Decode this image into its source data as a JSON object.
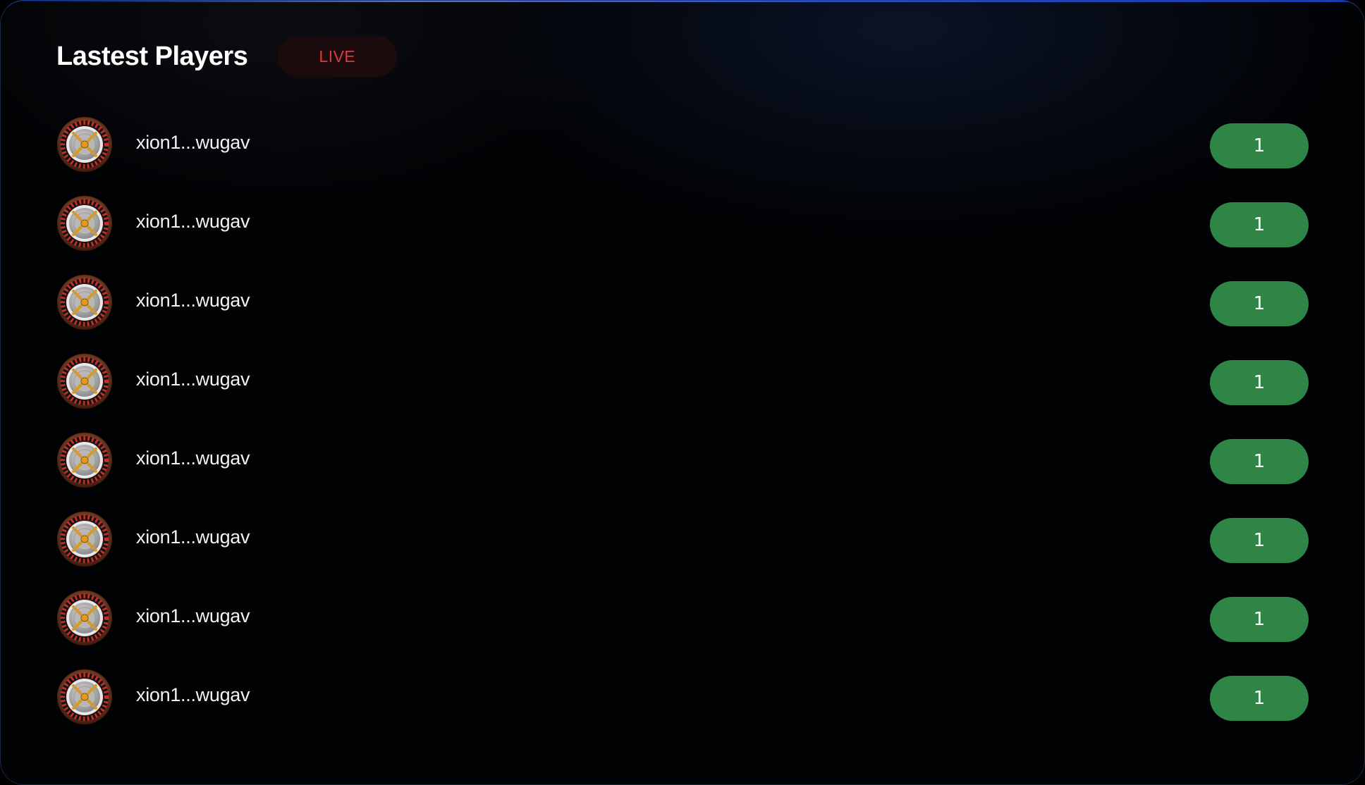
{
  "header": {
    "title": "Lastest Players",
    "live_label": "LIVE"
  },
  "players": [
    {
      "name": "xion1...wugav",
      "value": "1",
      "avatar_icon": "roulette-wheel-icon"
    },
    {
      "name": "xion1...wugav",
      "value": "1",
      "avatar_icon": "roulette-wheel-icon"
    },
    {
      "name": "xion1...wugav",
      "value": "1",
      "avatar_icon": "roulette-wheel-icon"
    },
    {
      "name": "xion1...wugav",
      "value": "1",
      "avatar_icon": "roulette-wheel-icon"
    },
    {
      "name": "xion1...wugav",
      "value": "1",
      "avatar_icon": "roulette-wheel-icon"
    },
    {
      "name": "xion1...wugav",
      "value": "1",
      "avatar_icon": "roulette-wheel-icon"
    },
    {
      "name": "xion1...wugav",
      "value": "1",
      "avatar_icon": "roulette-wheel-icon"
    },
    {
      "name": "xion1...wugav",
      "value": "1",
      "avatar_icon": "roulette-wheel-icon"
    }
  ],
  "colors": {
    "background": "#010204",
    "live_text": "#e0383f",
    "live_bg": "#1b0b0d",
    "value_pill": "#2f8546",
    "text": "#ffffff"
  }
}
